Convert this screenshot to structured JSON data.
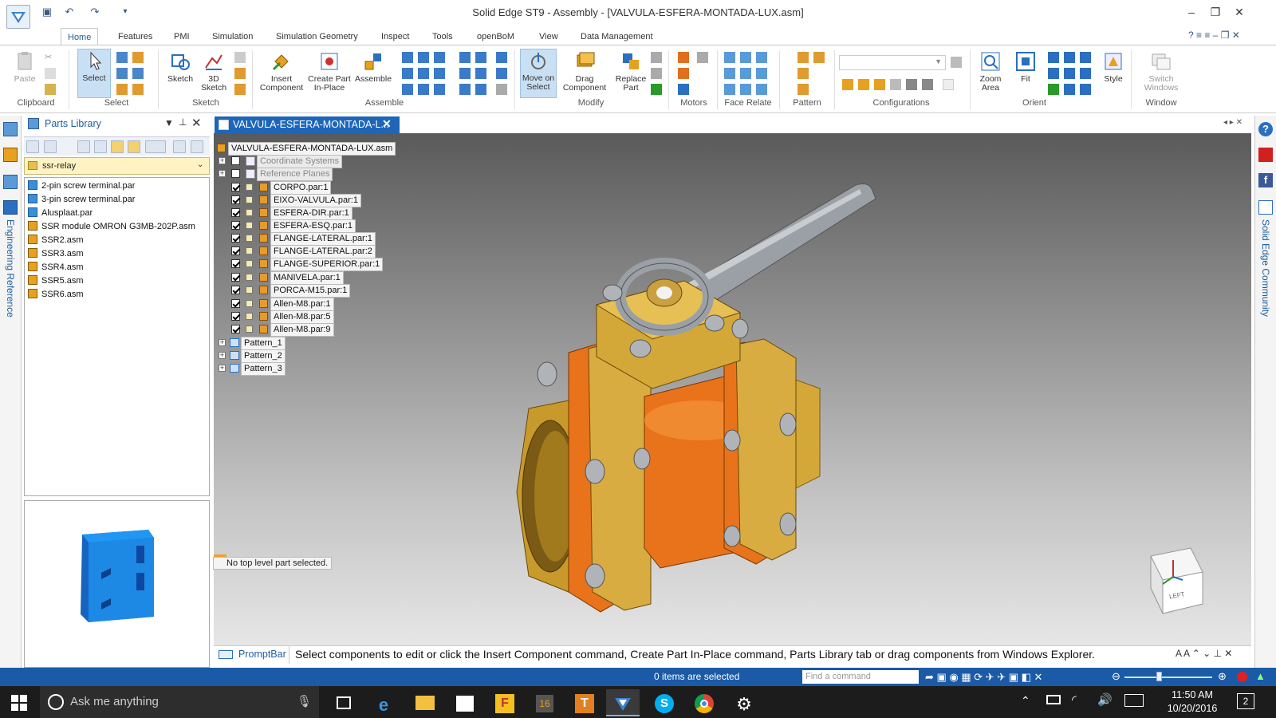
{
  "window": {
    "title": "Solid Edge ST9 - Assembly - [VALVULA-ESFERA-MONTADA-LUX.asm]"
  },
  "ribbon_tabs": [
    "Home",
    "Features",
    "PMI",
    "Simulation",
    "Simulation Geometry",
    "Inspect",
    "Tools",
    "openBoM",
    "View",
    "Data Management"
  ],
  "ribbon": {
    "paste": "Paste",
    "select": "Select",
    "sketch": "Sketch",
    "sketch3d": "3D Sketch",
    "insert_component": "Insert Component",
    "create_part": "Create Part In-Place",
    "assemble": "Assemble",
    "move_on_select": "Move on Select",
    "drag_component": "Drag Component",
    "replace_part": "Replace Part",
    "zoom_area": "Zoom Area",
    "fit": "Fit",
    "style": "Style",
    "switch_windows": "Switch Windows",
    "groups": {
      "clipboard": "Clipboard",
      "select": "Select",
      "sketch": "Sketch",
      "assemble": "Assemble",
      "modify": "Modify",
      "motors": "Motors",
      "face_relate": "Face Relate",
      "pattern": "Pattern",
      "configurations": "Configurations",
      "orient": "Orient",
      "window": "Window"
    }
  },
  "left_strip": {
    "engineering_reference": "Engineering Reference"
  },
  "parts_library": {
    "title": "Parts Library",
    "folder": "ssr-relay",
    "items": [
      "2-pin screw terminal.par",
      "3-pin screw terminal.par",
      "Alusplaat.par",
      "SSR module OMRON G3MB-202P.asm",
      "SSR2.asm",
      "SSR3.asm",
      "SSR4.asm",
      "SSR5.asm",
      "SSR6.asm"
    ]
  },
  "document": {
    "tab_title": "VALVULA-ESFERA-MONTADA-L...",
    "root": "VALVULA-ESFERA-MONTADA-LUX.asm",
    "coordinate_systems": "Coordinate Systems",
    "reference_planes": "Reference Planes",
    "parts": [
      "CORPO.par:1",
      "EIXO-VALVULA.par:1",
      "ESFERA-DIR.par:1",
      "ESFERA-ESQ.par:1",
      "FLANGE-LATERAL.par:1",
      "FLANGE-LATERAL.par:2",
      "FLANGE-SUPERIOR.par:1",
      "MANIVELA.par:1",
      "PORCA-M15.par:1",
      "Allen-M8.par:1",
      "Allen-M8.par:5",
      "Allen-M8.par:9"
    ],
    "patterns": [
      "Pattern_1",
      "Pattern_2",
      "Pattern_3"
    ],
    "selection_status": "No top level part selected.",
    "view_cube_label": "LEFT"
  },
  "prompt_bar": {
    "label": "PromptBar",
    "message": "Select components to edit or click the Insert Component command, Create Part In-Place command, Parts Library tab or drag components from Windows Explorer."
  },
  "status_bar": {
    "selection": "0 items are selected",
    "find_placeholder": "Find a command"
  },
  "right_strip": {
    "community": "Solid Edge Community"
  },
  "taskbar": {
    "search_placeholder": "Ask me anything",
    "time": "11:50 AM",
    "date": "10/20/2016",
    "notifications": "2"
  },
  "colors": {
    "accent": "#1d66b8",
    "statusbar": "#1b5aa7",
    "orange": "#e8731a",
    "brass": "#c9a227"
  }
}
